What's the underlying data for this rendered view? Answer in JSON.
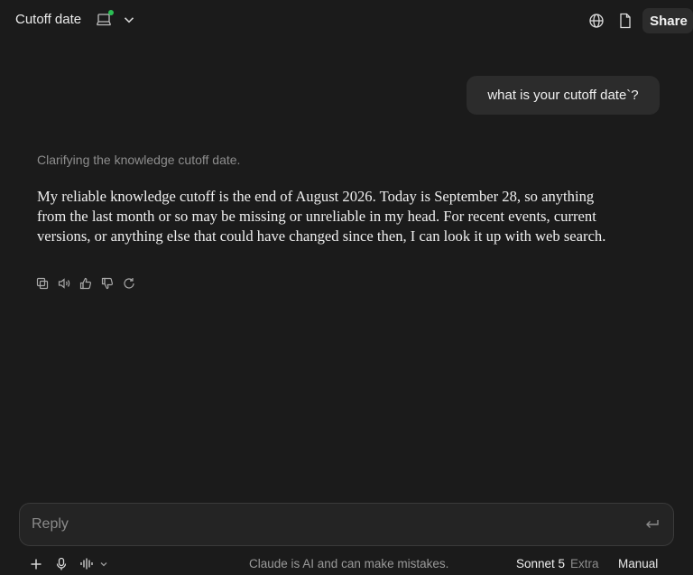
{
  "header": {
    "title": "Cutoff date",
    "share_label": "Share",
    "icons": [
      "computer-icon",
      "chevron-down-icon",
      "globe-icon",
      "document-icon"
    ],
    "status_dot_color": "#2bbf54"
  },
  "conversation": {
    "user_message": "what is your cutoff date`?",
    "thinking_summary": "Clarifying the knowledge cutoff date.",
    "assistant_message": "My reliable knowledge cutoff is the end of August 2026. Today is September 28, so anything from the last month or so may be missing or unreliable in my head. For recent events, current versions, or anything else that could have changed since then, I can look it up with web search.",
    "message_actions": [
      "copy-icon",
      "speaker-icon",
      "thumbs-up-icon",
      "thumbs-down-icon",
      "retry-icon"
    ]
  },
  "composer": {
    "placeholder": "Reply",
    "value": ""
  },
  "footer": {
    "disclaimer": "Claude is AI and can make mistakes.",
    "model_name": "Sonnet 5",
    "model_mode": "Extra",
    "manual_label": "Manual"
  },
  "colors": {
    "background": "#1b1b1b",
    "bubble": "#2c2c2c",
    "composer": "#242424"
  }
}
